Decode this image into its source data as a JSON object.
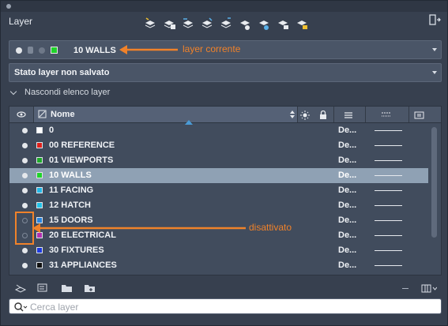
{
  "panel": {
    "title": "Layer"
  },
  "toolbar": {
    "icons": [
      "new-layer-icon",
      "new-layer-vp-frozen-icon",
      "delete-layer-icon",
      "set-current-icon",
      "layer-states-icon",
      "isolate-layer-icon",
      "unisolate-icon",
      "freeze-layer-icon",
      "lock-layer-icon"
    ]
  },
  "current_layer": {
    "name": "10 WALLS",
    "color": "#1fd32a"
  },
  "layer_state": {
    "label": "Stato layer non salvato"
  },
  "collapse_toggle": {
    "label": "Nascondi elenco layer"
  },
  "table": {
    "header": {
      "name": "Nome"
    },
    "rows": [
      {
        "name": "0",
        "color": "#ffffff",
        "linetype": "De...",
        "on": true,
        "selected": false
      },
      {
        "name": "00 REFERENCE",
        "color": "#e0201b",
        "linetype": "De...",
        "on": true,
        "selected": false
      },
      {
        "name": "01 VIEWPORTS",
        "color": "#1faa2a",
        "linetype": "De...",
        "on": true,
        "selected": false
      },
      {
        "name": "10 WALLS",
        "color": "#1fd32a",
        "linetype": "De...",
        "on": true,
        "selected": true
      },
      {
        "name": "11 FACING",
        "color": "#22b8e8",
        "linetype": "De...",
        "on": true,
        "selected": false
      },
      {
        "name": "12 HATCH",
        "color": "#22c2e8",
        "linetype": "De...",
        "on": true,
        "selected": false
      },
      {
        "name": "15 DOORS",
        "color": "#2a86e0",
        "linetype": "De...",
        "on": false,
        "selected": false
      },
      {
        "name": "20 ELECTRICAL",
        "color": "#b22fb0",
        "linetype": "De...",
        "on": false,
        "selected": false
      },
      {
        "name": "30 FIXTURES",
        "color": "#1d3ae0",
        "linetype": "De...",
        "on": true,
        "selected": false
      },
      {
        "name": "31 APPLIANCES",
        "color": "#101010",
        "linetype": "De...",
        "on": true,
        "selected": false
      }
    ]
  },
  "search": {
    "placeholder": "Cerca layer"
  },
  "annotations": {
    "current_layer": "layer corrente",
    "off": "disattivato",
    "color": "#f0822a"
  }
}
